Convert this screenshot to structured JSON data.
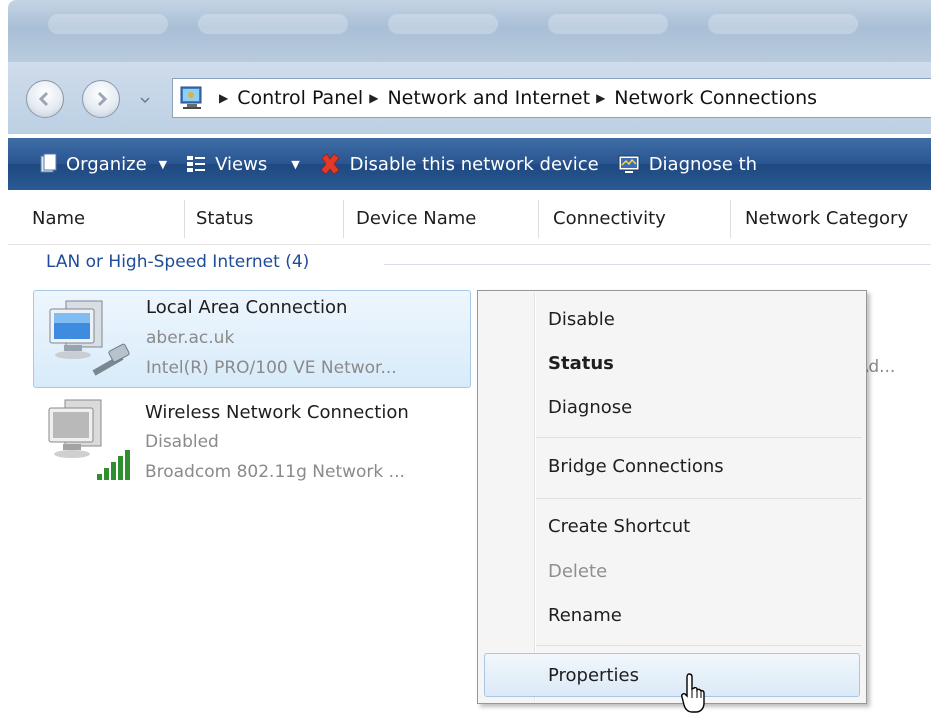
{
  "breadcrumb": {
    "items": [
      "Control Panel",
      "Network and Internet",
      "Network Connections"
    ]
  },
  "toolbar": {
    "organize": "Organize",
    "views": "Views",
    "disable_device": "Disable this network device",
    "diagnose": "Diagnose th"
  },
  "columns": [
    "Name",
    "Status",
    "Device Name",
    "Connectivity",
    "Network Category"
  ],
  "group": {
    "label": "LAN or High-Speed Internet (4)"
  },
  "connections": [
    {
      "name": "Local Area Connection",
      "status": "aber.ac.uk",
      "device": "Intel(R) PRO/100 VE Networ...",
      "selected": true
    },
    {
      "name": "Wireless Network Connection",
      "status": "Disabled",
      "device": "Broadcom 802.11g Network ...",
      "selected": false
    }
  ],
  "overflow_text": "Ad...",
  "context_menu": {
    "items": [
      {
        "label": "Disable",
        "style": "normal"
      },
      {
        "label": "Status",
        "style": "bold"
      },
      {
        "label": "Diagnose",
        "style": "normal"
      },
      {
        "label": "Bridge Connections",
        "style": "normal"
      },
      {
        "label": "Create Shortcut",
        "style": "normal"
      },
      {
        "label": "Delete",
        "style": "disabled"
      },
      {
        "label": "Rename",
        "style": "normal"
      },
      {
        "label": "Properties",
        "style": "highlighted"
      }
    ]
  },
  "colors": {
    "toolbar_blue": "#2a5590",
    "group_header": "#1f4b99",
    "selection": "#d8ebfa",
    "disabled_text": "#8f8f8f"
  }
}
